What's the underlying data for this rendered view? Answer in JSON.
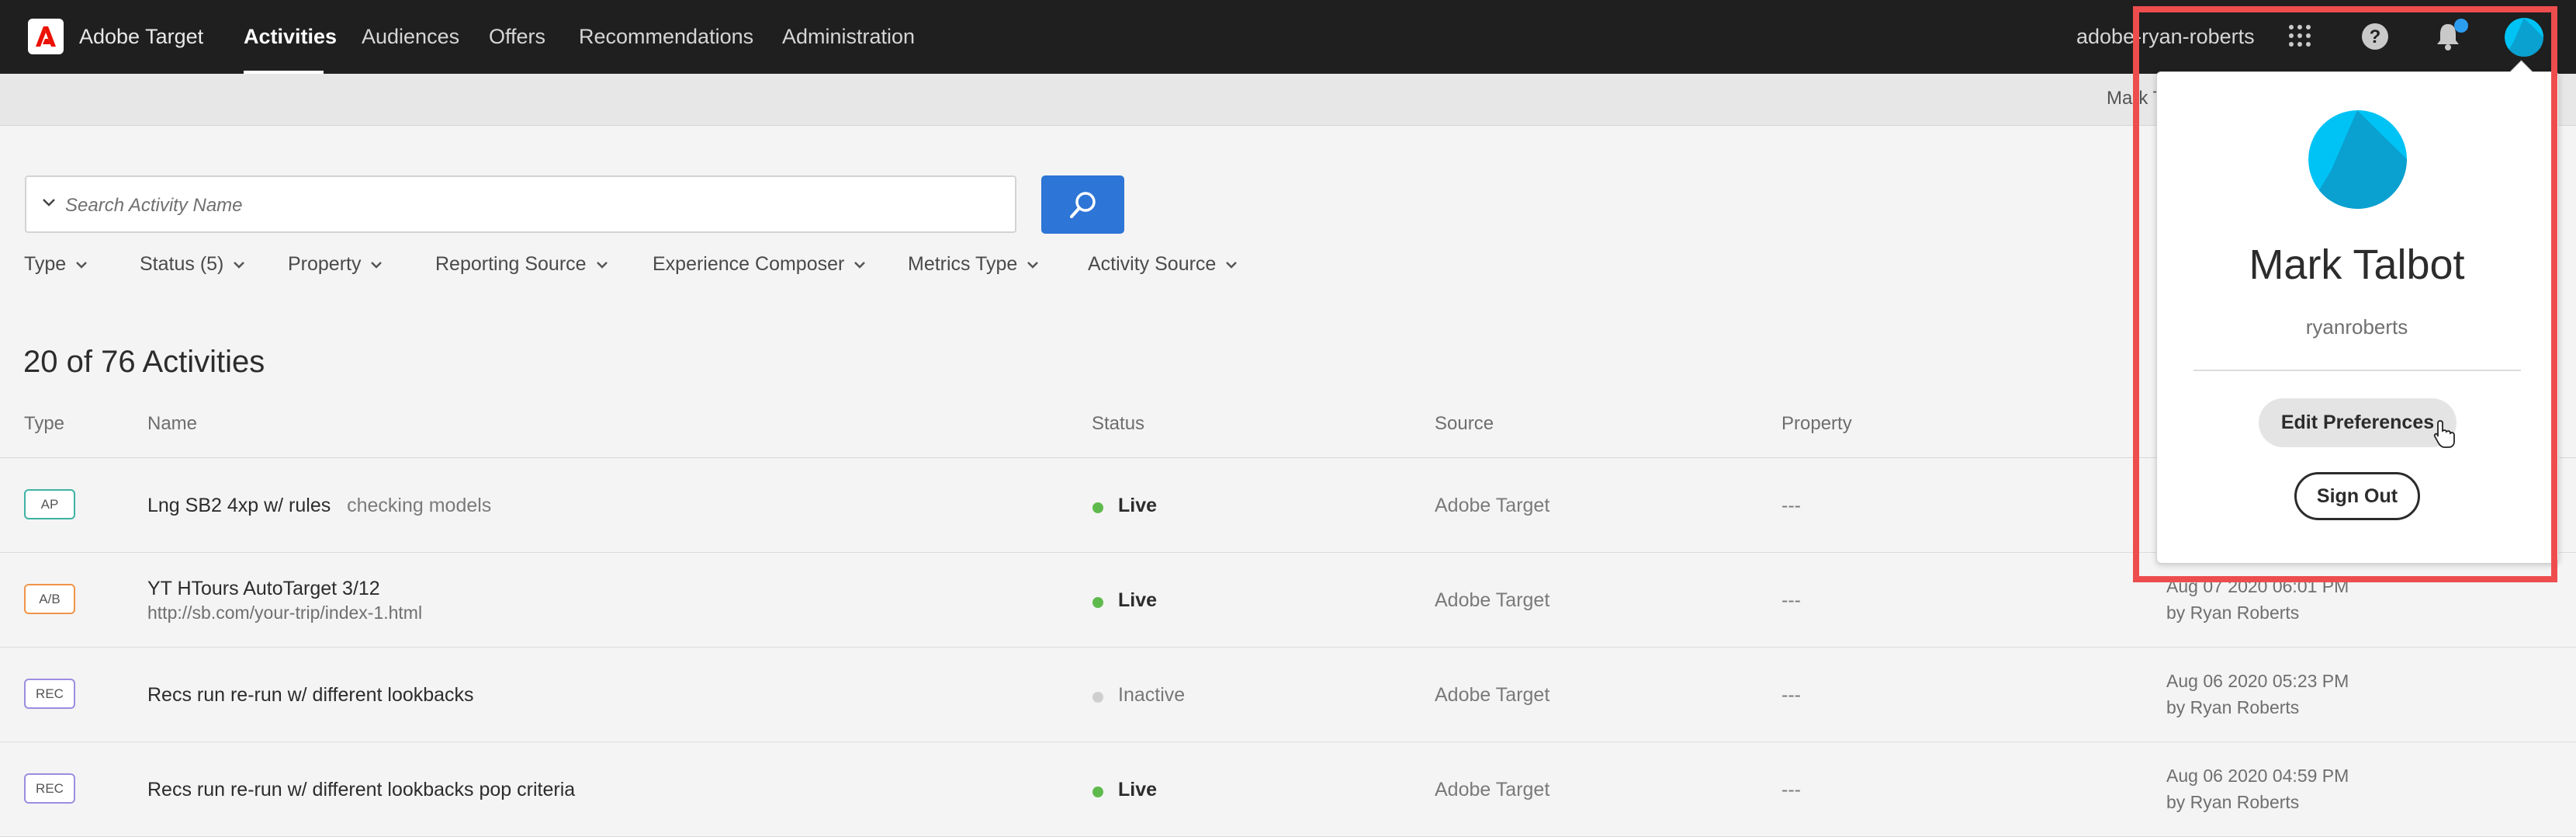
{
  "app": {
    "name": "Adobe Target"
  },
  "nav": {
    "tabs": [
      {
        "label": "Activities",
        "active": true
      },
      {
        "label": "Audiences"
      },
      {
        "label": "Offers"
      },
      {
        "label": "Recommendations"
      },
      {
        "label": "Administration"
      }
    ],
    "user_id": "adobe-ryan-roberts",
    "icons": [
      "apps-grid-icon",
      "help-icon",
      "bell-icon",
      "avatar"
    ],
    "accent": "#2d9df0"
  },
  "subbar": {
    "text": "Mark T"
  },
  "search": {
    "placeholder": "Search Activity Name",
    "button_color": "#2d75d6"
  },
  "filters": [
    {
      "label": "Type"
    },
    {
      "label": "Status (5)"
    },
    {
      "label": "Property"
    },
    {
      "label": "Reporting Source"
    },
    {
      "label": "Experience Composer"
    },
    {
      "label": "Metrics Type"
    },
    {
      "label": "Activity Source"
    }
  ],
  "summary": {
    "title": "20 of 76 Activities"
  },
  "table": {
    "columns": [
      "Type",
      "Name",
      "Status",
      "Source",
      "Property"
    ],
    "rows": [
      {
        "type": "AP",
        "type_color": "#3fb2a3",
        "name": "Lng SB2 4xp w/ rules",
        "note": "checking models",
        "url": "",
        "status": "Live",
        "status_color": "#5fba4d",
        "source": "Adobe Target",
        "property": "---",
        "modified": "",
        "by": ""
      },
      {
        "type": "A/B",
        "type_color": "#f09448",
        "name": "YT HTours AutoTarget 3/12",
        "note": "",
        "url": "http://sb.com/your-trip/index-1.html",
        "status": "Live",
        "status_color": "#5fba4d",
        "source": "Adobe Target",
        "property": "---",
        "modified": "Aug 07 2020 06:01 PM",
        "by": "by Ryan Roberts"
      },
      {
        "type": "REC",
        "type_color": "#9d8de0",
        "name": "Recs run re-run w/ different lookbacks",
        "note": "",
        "url": "",
        "status": "Inactive",
        "status_color": "#cfcfcf",
        "source": "Adobe Target",
        "property": "---",
        "modified": "Aug 06 2020 05:23 PM",
        "by": "by Ryan Roberts"
      },
      {
        "type": "REC",
        "type_color": "#9d8de0",
        "name": "Recs run re-run w/ different lookbacks pop criteria",
        "note": "",
        "url": "",
        "status": "Live",
        "status_color": "#5fba4d",
        "source": "Adobe Target",
        "property": "---",
        "modified": "Aug 06 2020 04:59 PM",
        "by": "by Ryan Roberts"
      }
    ]
  },
  "profile_popup": {
    "name": "Mark Talbot",
    "username": "ryanroberts",
    "edit_label": "Edit Preferences",
    "signout_label": "Sign Out",
    "highlight_color": "#ee4d4e"
  }
}
